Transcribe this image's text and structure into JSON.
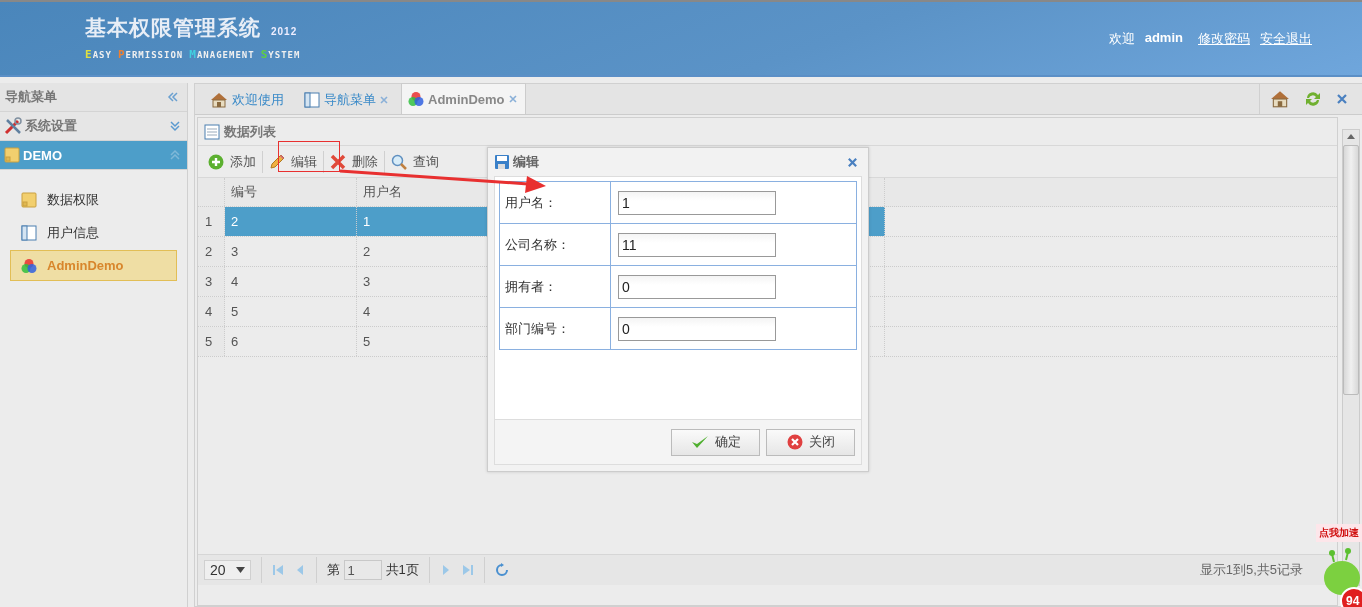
{
  "header": {
    "title": "基本权限管理系统",
    "year": "2012",
    "subtitle": [
      {
        "initial": "E",
        "rest": "ASY",
        "color": "#e0e040"
      },
      {
        "initial": "P",
        "rest": "ERMISSION",
        "color": "#f08030"
      },
      {
        "initial": "M",
        "rest": "ANAGEMENT",
        "color": "#40d0e0"
      },
      {
        "initial": "S",
        "rest": "YSTEM",
        "color": "#60d040"
      }
    ],
    "welcome": "欢迎",
    "user": "admin",
    "links": [
      "修改密码",
      "安全退出"
    ]
  },
  "sidebar": {
    "title": "导航菜单",
    "groups": [
      {
        "label": "系统设置",
        "kind": "tools",
        "expanded": false
      },
      {
        "label": "DEMO",
        "kind": "note",
        "expanded": true,
        "items": [
          {
            "label": "数据权限",
            "kind": "note",
            "selected": false
          },
          {
            "label": "用户信息",
            "kind": "layout",
            "selected": false
          },
          {
            "label": "AdminDemo",
            "kind": "colors",
            "selected": true
          }
        ]
      }
    ]
  },
  "tabs": [
    {
      "label": "欢迎使用",
      "kind": "home",
      "closable": false,
      "selected": false
    },
    {
      "label": "导航菜单",
      "kind": "layout",
      "closable": true,
      "selected": false
    },
    {
      "label": "AdminDemo",
      "kind": "colors",
      "closable": true,
      "selected": true
    }
  ],
  "panel": {
    "title": "数据列表",
    "toolbar": [
      {
        "label": "添加",
        "kind": "add"
      },
      {
        "label": "编辑",
        "kind": "edit"
      },
      {
        "label": "删除",
        "kind": "delete"
      },
      {
        "label": "查询",
        "kind": "search"
      }
    ],
    "columns": [
      "编号",
      "用户名"
    ],
    "rows": [
      {
        "number": "1",
        "cells": [
          "2",
          "1"
        ],
        "selected": true
      },
      {
        "number": "2",
        "cells": [
          "3",
          "2"
        ],
        "selected": false
      },
      {
        "number": "3",
        "cells": [
          "4",
          "3"
        ],
        "selected": false
      },
      {
        "number": "4",
        "cells": [
          "5",
          "4"
        ],
        "selected": false
      },
      {
        "number": "5",
        "cells": [
          "6",
          "5"
        ],
        "selected": false
      }
    ],
    "pager": {
      "page_size": "20",
      "before": "第",
      "page": "1",
      "after": "共1页",
      "summary": "显示1到5,共5记录"
    }
  },
  "dialog": {
    "title": "编辑",
    "fields": [
      {
        "label": "用户名：",
        "value": "1"
      },
      {
        "label": "公司名称：",
        "value": "11"
      },
      {
        "label": "拥有者：",
        "value": "0"
      },
      {
        "label": "部门编号：",
        "value": "0"
      }
    ],
    "buttons": [
      {
        "label": "确定",
        "kind": "ok"
      },
      {
        "label": "关闭",
        "kind": "cancel"
      }
    ]
  },
  "widget": {
    "bubble": "点我加速",
    "badge": "94"
  }
}
